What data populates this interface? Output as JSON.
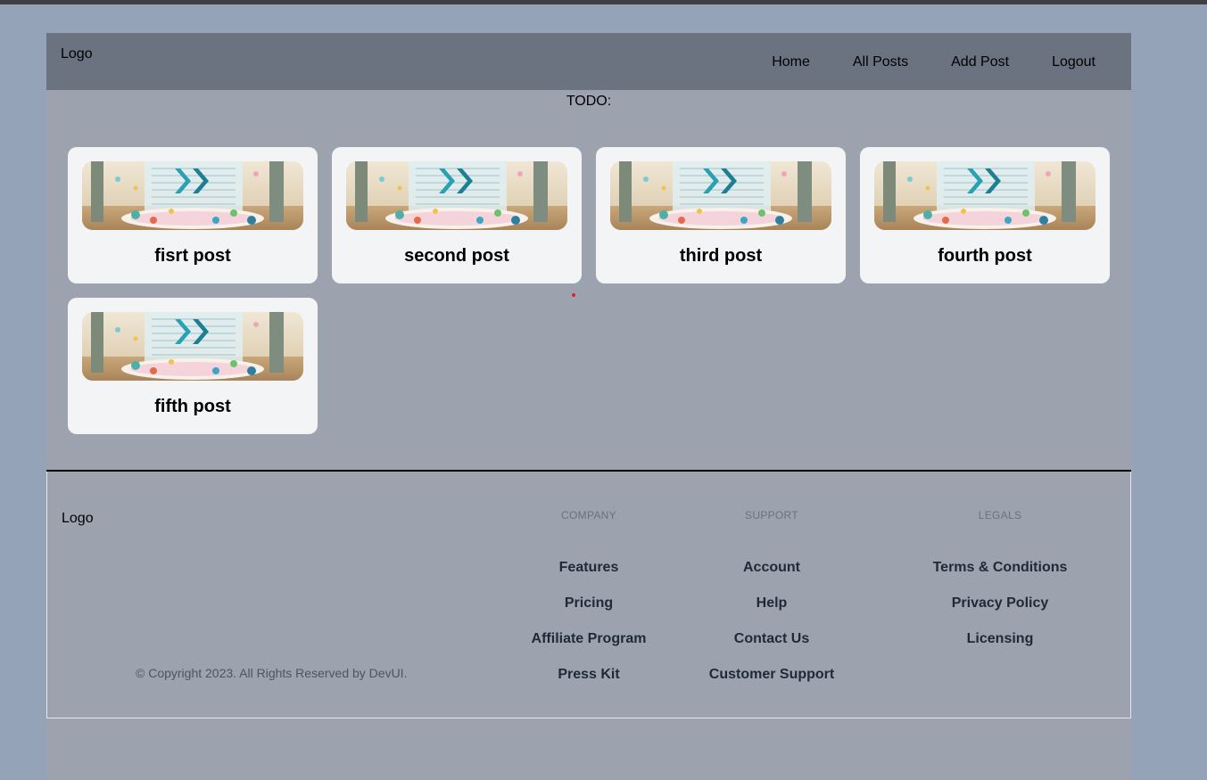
{
  "header": {
    "logo": "Logo",
    "nav": [
      "Home",
      "All Posts",
      "Add Post",
      "Logout"
    ]
  },
  "todo_label": "TODO:",
  "posts": [
    {
      "title": "fisrt post"
    },
    {
      "title": "second post"
    },
    {
      "title": "third post"
    },
    {
      "title": "fourth post"
    },
    {
      "title": "fifth post"
    }
  ],
  "footer": {
    "logo": "Logo",
    "copyright": "© Copyright 2023. All Rights Reserved by DevUI.",
    "columns": [
      {
        "heading": "COMPANY",
        "links": [
          "Features",
          "Pricing",
          "Affiliate Program",
          "Press Kit"
        ]
      },
      {
        "heading": "SUPPORT",
        "links": [
          "Account",
          "Help",
          "Contact Us",
          "Customer Support"
        ]
      },
      {
        "heading": "LEGALS",
        "links": [
          "Terms & Conditions",
          "Privacy Policy",
          "Licensing"
        ]
      }
    ]
  },
  "colors": {
    "page_bg": "#94a3b8",
    "content_bg": "#9ca3af",
    "navbar_bg": "#6b7280",
    "card_bg": "#f3f4f6"
  }
}
